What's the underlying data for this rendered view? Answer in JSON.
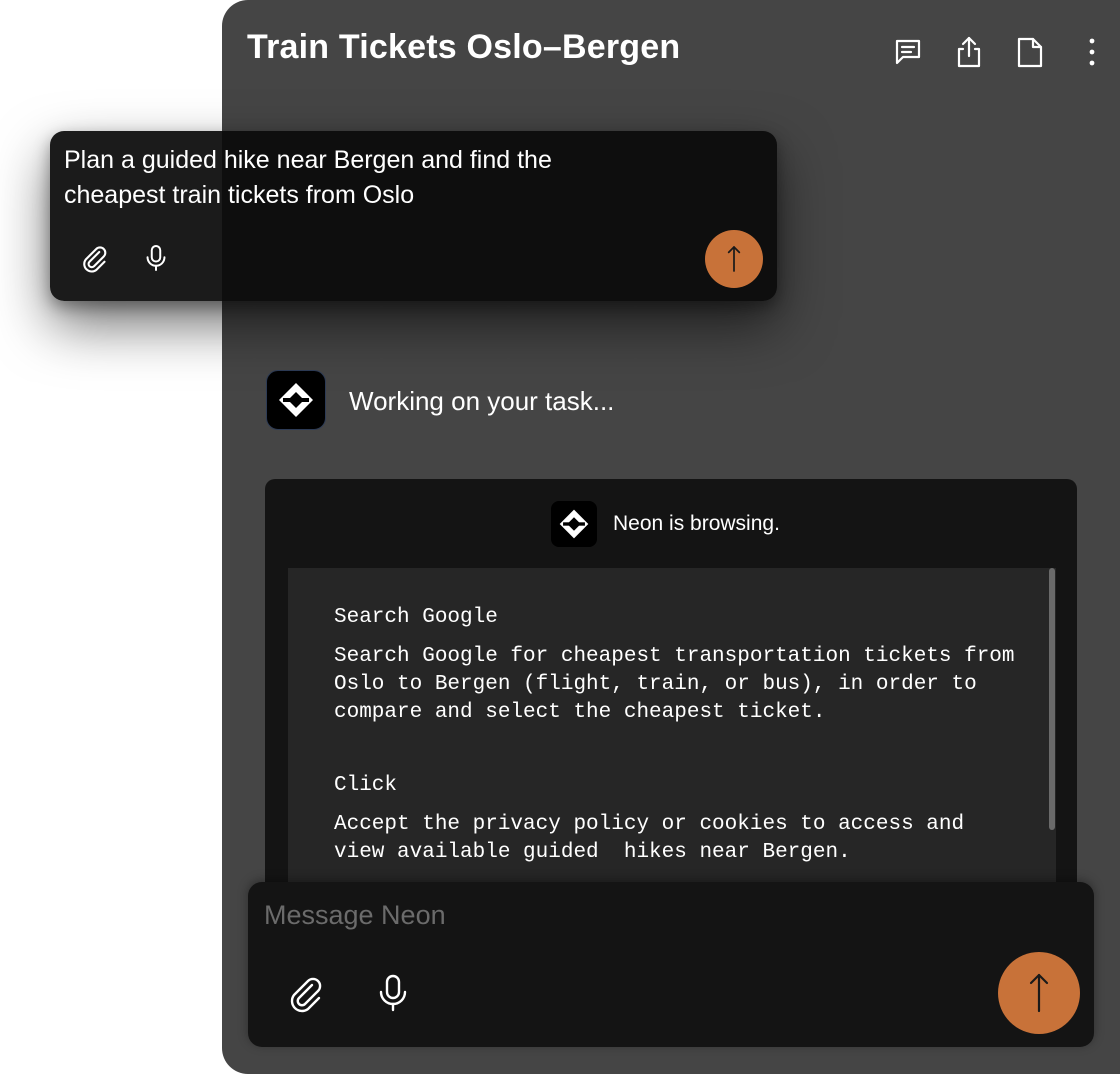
{
  "header": {
    "title": "Train Tickets Oslo–Bergen",
    "icons": [
      "chat-icon",
      "share-icon",
      "document-icon",
      "more-vertical-icon"
    ]
  },
  "status": {
    "text": "Working on your task...",
    "avatar_icon": "neon-logo-icon"
  },
  "browsing": {
    "label": "Neon is browsing.",
    "steps": [
      {
        "action": "Search Google",
        "description": "Search Google for cheapest transportation tickets from Oslo to Bergen (flight, train, or bus), in order to compare and select the cheapest ticket."
      },
      {
        "action": "Click",
        "description": "Accept the privacy policy or cookies to access and view available guided  hikes near Bergen."
      }
    ]
  },
  "composer": {
    "placeholder": "Message Neon",
    "value": "",
    "icons": [
      "paperclip-icon",
      "microphone-icon",
      "send-arrow-icon"
    ]
  },
  "prompt_popup": {
    "text": "Plan a guided hike near Bergen and find the cheapest train tickets from Oslo",
    "icons": [
      "paperclip-icon",
      "microphone-icon",
      "send-arrow-icon"
    ]
  },
  "colors": {
    "panel_bg": "#454545",
    "card_bg": "#141414",
    "log_bg": "#262626",
    "accent_send": "#c87239",
    "text": "#ffffff",
    "placeholder": "#6b6b6b"
  }
}
